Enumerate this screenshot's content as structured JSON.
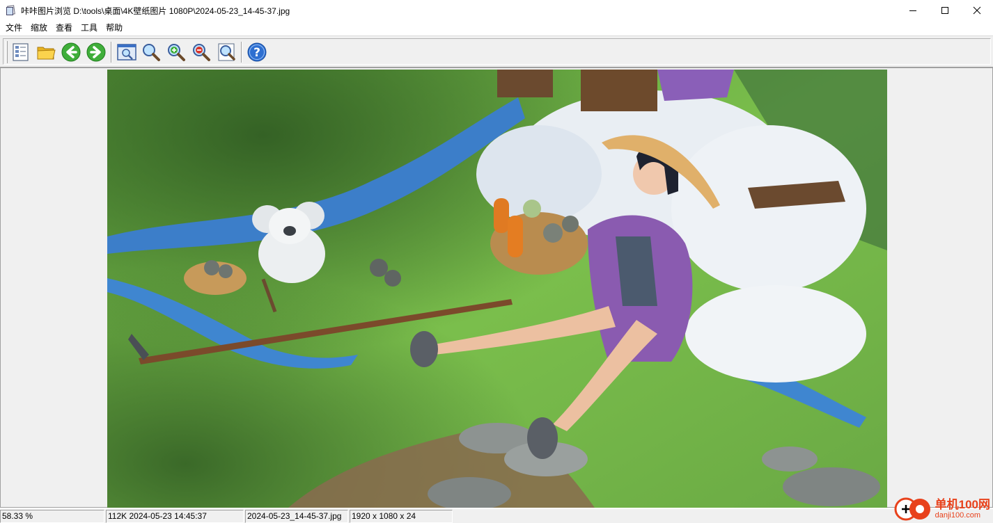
{
  "window": {
    "title": "咔咔图片浏览 D:\\tools\\桌面\\4K壁纸图片 1080P\\2024-05-23_14-45-37.jpg",
    "controls": [
      "minimize-icon",
      "maximize-icon",
      "close-icon"
    ]
  },
  "menu": {
    "file": "文件",
    "zoom": "缩放",
    "view": "查看",
    "tools": "工具",
    "help": "帮助"
  },
  "toolbar": {
    "buttons": [
      "file-list-icon",
      "open-folder-icon",
      "previous-arrow-icon",
      "next-arrow-icon",
      "fit-window-icon",
      "zoom-icon",
      "zoom-in-icon",
      "zoom-out-icon",
      "actual-size-icon",
      "help-icon"
    ]
  },
  "image": {
    "description_icon": "anime-wallpaper-image"
  },
  "status": {
    "zoom": "58.33 %",
    "size_date": "112K 2024-05-23 14:45:37",
    "filename": "2024-05-23_14-45-37.jpg",
    "dimensions": "1920 x 1080 x 24"
  },
  "watermark": {
    "main": "单机100网",
    "sub": "danji100.com"
  },
  "colors": {
    "accent_green": "#3fae3a",
    "watermark_red": "#e8411b"
  }
}
